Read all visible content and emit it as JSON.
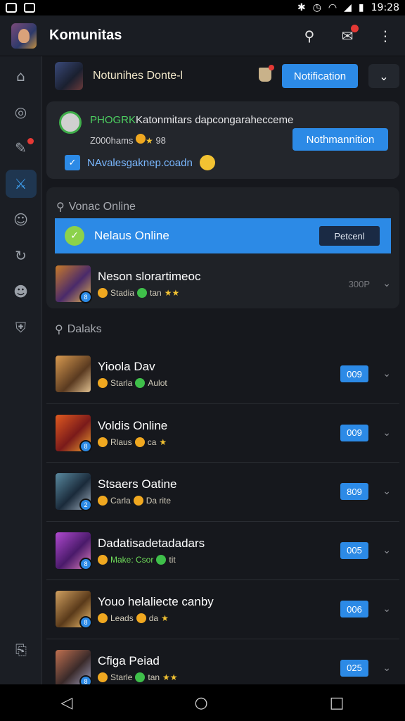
{
  "status_bar": {
    "time": "19:28"
  },
  "app_bar": {
    "title": "Komunitas"
  },
  "top_card": {
    "name": "Notunihes Donte-l",
    "button": "Notification"
  },
  "notification": {
    "line1_prefix": "PHOGRK",
    "line1_rest": "Katonmitars dapcongarahecceme",
    "line2": "Z000hams",
    "line2_tail": "98",
    "line3": "NAvalesgaknep.coadn",
    "button": "Nothmannition"
  },
  "online_section": {
    "header": "Vonac Online",
    "highlight_label": "Nelaus Online",
    "highlight_button": "Petcenl",
    "row": {
      "name": "Neson slorartimeoc",
      "meta1": "Stadia",
      "meta2": "tan",
      "count": "300P"
    }
  },
  "dalaks_section": {
    "header": "Dalaks",
    "rows": [
      {
        "name": "Yioola Dav",
        "meta1": "Starla",
        "meta2": "Aulot",
        "count": "009"
      },
      {
        "name": "Voldis Online",
        "meta1": "Rlaus",
        "meta2": "ca",
        "count": "009"
      },
      {
        "name": "Stsaers Oatine",
        "meta1": "Carla",
        "meta2": "Da rite",
        "count": "809"
      },
      {
        "name": "Dadatisadetadadars",
        "meta1": "Make: Csor",
        "meta2": "tit",
        "count": "005"
      },
      {
        "name": "Youo helaliecte canby",
        "meta1": "Leads",
        "meta2": "da",
        "count": "006"
      },
      {
        "name": "Cfiga Peiad",
        "meta1": "Starle",
        "meta2": "tan",
        "count": "025"
      }
    ]
  },
  "colors": {
    "accent": "#2c8ae6",
    "bg": "#16181d",
    "card": "#23262c",
    "success": "#3fbf4a",
    "coin": "#f0a820"
  }
}
